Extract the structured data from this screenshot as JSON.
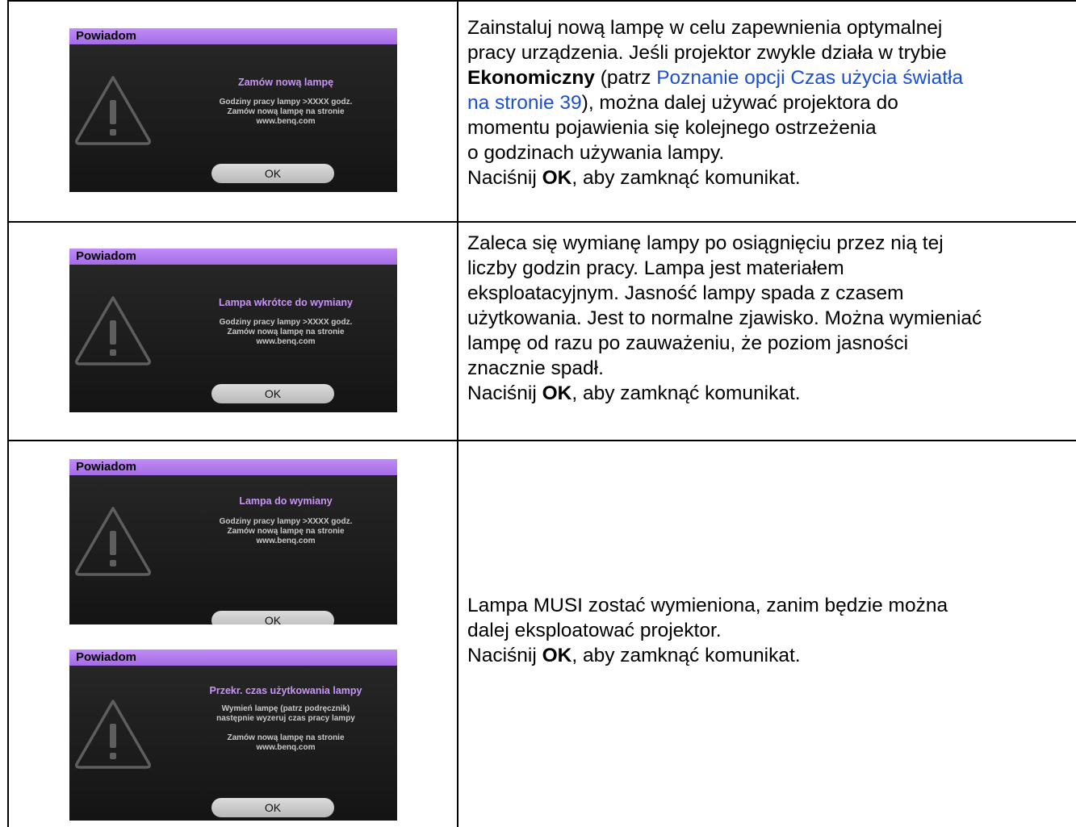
{
  "rows": [
    {
      "dialogs": [
        {
          "title": "Powiadom",
          "heading": "Zamów nową lampę",
          "lines": [
            "Godziny pracy lampy  >XXXX godz.",
            "Zamów nową lampę na stronie",
            "www.benq.com"
          ],
          "ok": "OK"
        }
      ],
      "description": {
        "l1": "Zainstaluj nową lampę w celu zapewnienia optymalnej",
        "l2": "pracy urządzenia. Jeśli projektor zwykle działa w trybie",
        "l3_bold": "Ekonomiczny",
        "l3_mid": " (patrz ",
        "l3_link": "Poznanie opcji Czas użycia światła",
        "l4_link": "na stronie 39",
        "l4_rest": "), można dalej używać projektora do",
        "l5": "momentu pojawienia się kolejnego ostrzeżenia",
        "l6": "o godzinach używania lampy.",
        "close_pre": "Naciśnij ",
        "close_bold": "OK",
        "close_post": ", aby zamknąć komunikat."
      }
    },
    {
      "dialogs": [
        {
          "title": "Powiadom",
          "heading": "Lampa wkrótce do wymiany",
          "lines": [
            "Godziny pracy lampy  >XXXX godz.",
            "Zamów nową lampę na stronie",
            "www.benq.com"
          ],
          "ok": "OK"
        }
      ],
      "description": {
        "l1": "Zaleca się wymianę lampy po osiągnięciu przez nią tej",
        "l2": "liczby godzin pracy. Lampa jest materiałem",
        "l3": "eksploatacyjnym. Jasność lampy spada z czasem",
        "l4": "użytkowania. Jest to normalne zjawisko. Można wymieniać",
        "l5": "lampę od razu po zauważeniu, że poziom jasności",
        "l6": "znacznie spadł.",
        "close_pre": "Naciśnij ",
        "close_bold": "OK",
        "close_post": ", aby zamknąć komunikat."
      }
    },
    {
      "dialogs": [
        {
          "title": "Powiadom",
          "heading": "Lampa do wymiany",
          "lines": [
            "Godziny pracy lampy  >XXXX godz.",
            "Zamów nową lampę na stronie",
            "www.benq.com"
          ],
          "ok": "OK"
        },
        {
          "title": "Powiadom",
          "heading": "Przekr. czas użytkowania lampy",
          "lines": [
            "Wymień lampę (patrz podręcznik)",
            "następnie wyzeruj czas pracy lampy",
            "",
            "Zamów nową lampę na stronie",
            "www.benq.com"
          ],
          "ok": "OK"
        }
      ],
      "description": {
        "l1": "Lampa MUSI zostać wymieniona, zanim będzie można",
        "l2": "dalej eksploatować projektor.",
        "close_pre": "Naciśnij ",
        "close_bold": "OK",
        "close_post": ", aby zamknąć komunikat."
      }
    }
  ],
  "colors": {
    "link": "#1a4fd6",
    "osd_title_bar": "#a46be6",
    "osd_heading": "#c795f5"
  },
  "icons": [
    "warning-triangle-icon"
  ]
}
